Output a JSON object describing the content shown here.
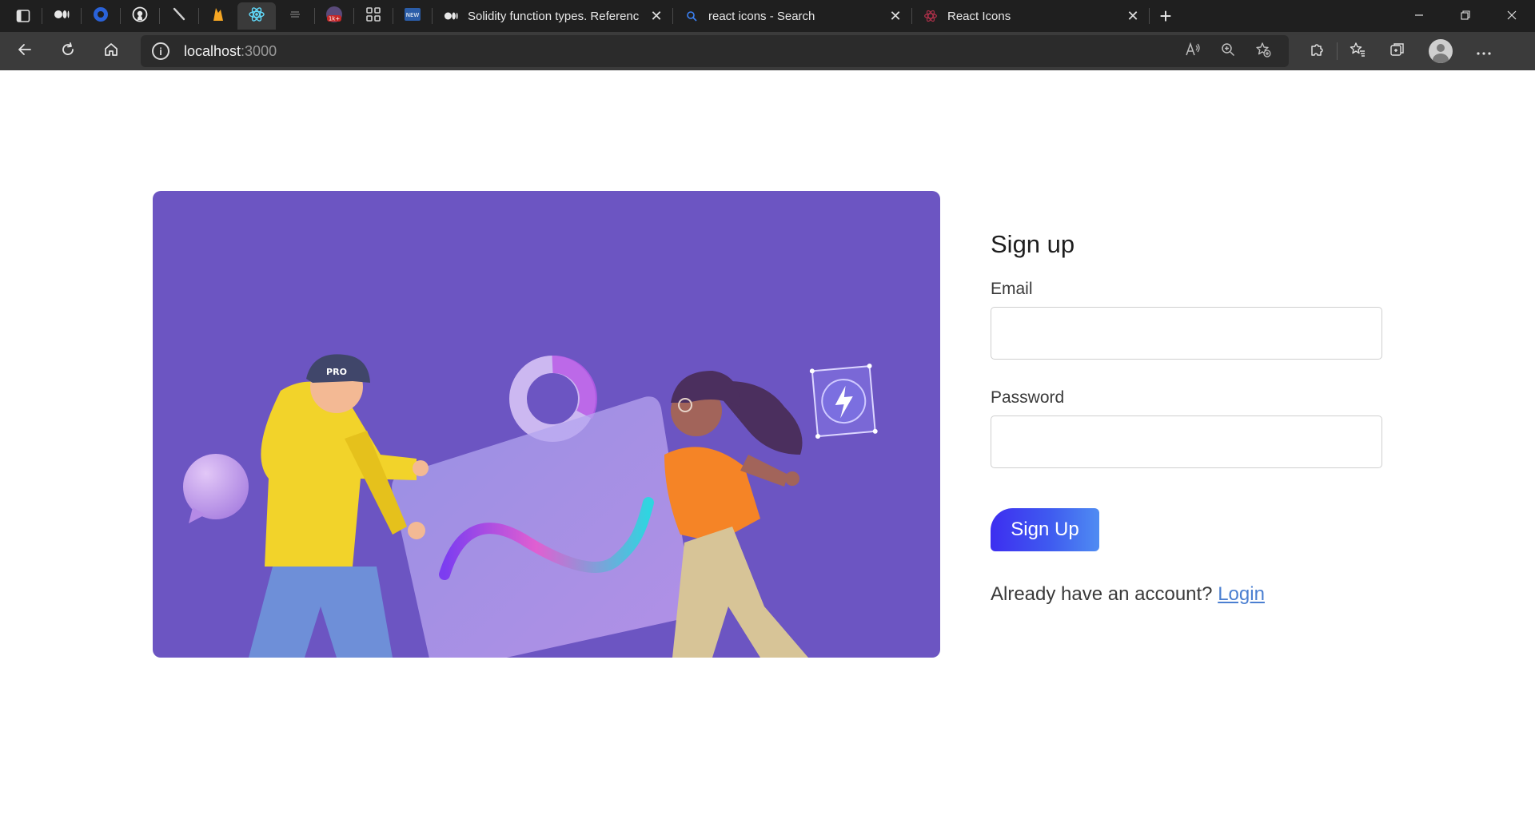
{
  "browser": {
    "tabs": [
      {
        "title": "Solidity function types. Referenc",
        "favicon": "medium-icon"
      },
      {
        "title": "react icons - Search",
        "favicon": "search-icon"
      },
      {
        "title": "React Icons",
        "favicon": "react-icon"
      }
    ],
    "pinned_tabs": [
      "medium-icon",
      "circle-icon",
      "github-icon",
      "feather-icon",
      "firebase-icon",
      "react-icon",
      "strike-icon",
      "badge-icon",
      "grid-icon",
      "news-icon"
    ],
    "pinned_badges": {
      "badge": "1k+",
      "news": "NEW"
    },
    "address": {
      "host": "localhost",
      "port": ":3000"
    }
  },
  "form": {
    "title": "Sign up",
    "email_label": "Email",
    "email_value": "",
    "password_label": "Password",
    "password_value": "",
    "submit_label": "Sign Up",
    "login_prompt": "Already have an account?",
    "login_link": "Login"
  },
  "hero": {
    "cap_text": "PRO",
    "background_color": "#6c55c2"
  },
  "colors": {
    "button_start": "#3d2ef0",
    "button_end": "#4f8cf2",
    "link": "#4b7fd1"
  }
}
